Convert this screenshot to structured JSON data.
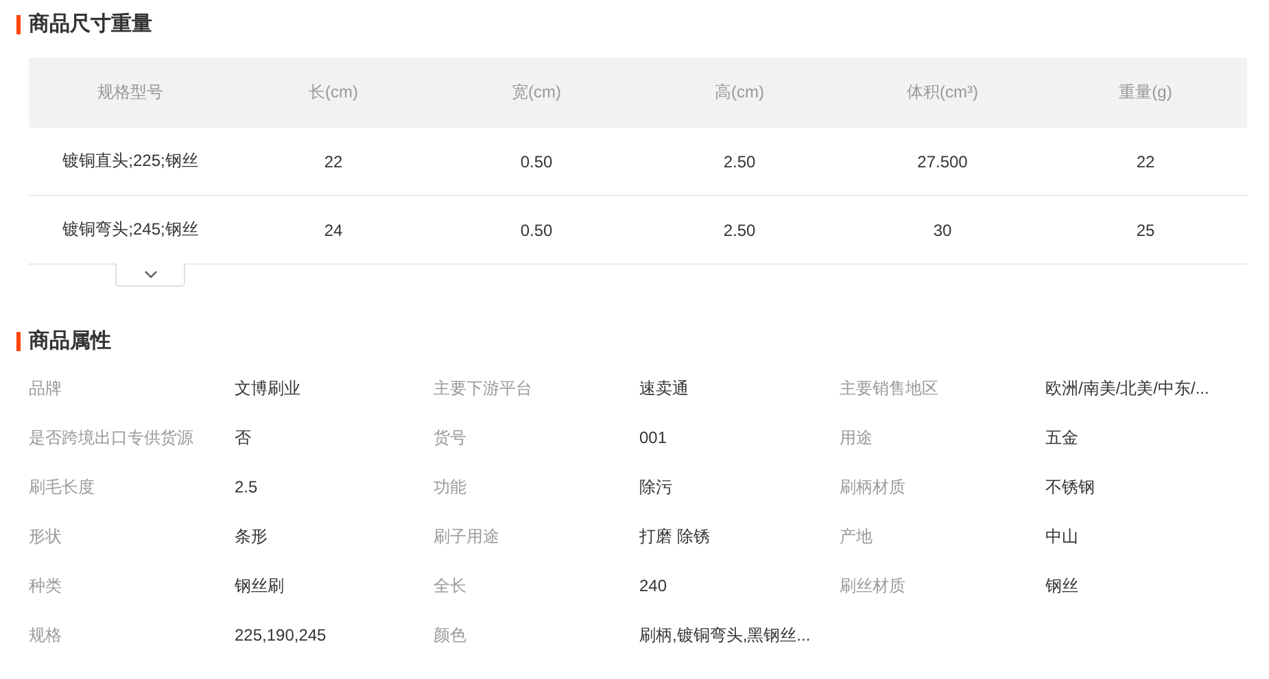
{
  "size_section": {
    "title": "商品尺寸重量",
    "columns": [
      "规格型号",
      "长(cm)",
      "宽(cm)",
      "高(cm)",
      "体积(cm³)",
      "重量(g)"
    ],
    "rows": [
      [
        "镀铜直头;225;钢丝",
        "22",
        "0.50",
        "2.50",
        "27.500",
        "22"
      ],
      [
        "镀铜弯头;245;钢丝",
        "24",
        "0.50",
        "2.50",
        "30",
        "25"
      ]
    ],
    "expanded": false
  },
  "attributes_section": {
    "title": "商品属性",
    "items": [
      {
        "label": "品牌",
        "value": "文博刷业"
      },
      {
        "label": "主要下游平台",
        "value": "速卖通"
      },
      {
        "label": "主要销售地区",
        "value": "欧洲/南美/北美/中东/..."
      },
      {
        "label": "是否跨境出口专供货源",
        "value": "否"
      },
      {
        "label": "货号",
        "value": "001"
      },
      {
        "label": "用途",
        "value": "五金"
      },
      {
        "label": "刷毛长度",
        "value": "2.5"
      },
      {
        "label": "功能",
        "value": "除污"
      },
      {
        "label": "刷柄材质",
        "value": "不锈钢"
      },
      {
        "label": "形状",
        "value": "条形"
      },
      {
        "label": "刷子用途",
        "value": "打磨 除锈"
      },
      {
        "label": "产地",
        "value": "中山"
      },
      {
        "label": "种类",
        "value": "钢丝刷"
      },
      {
        "label": "全长",
        "value": "240"
      },
      {
        "label": "刷丝材质",
        "value": "钢丝"
      },
      {
        "label": "规格",
        "value": "225,190,245"
      },
      {
        "label": "颜色",
        "value": "刷柄,镀铜弯头,黑钢丝..."
      }
    ]
  }
}
